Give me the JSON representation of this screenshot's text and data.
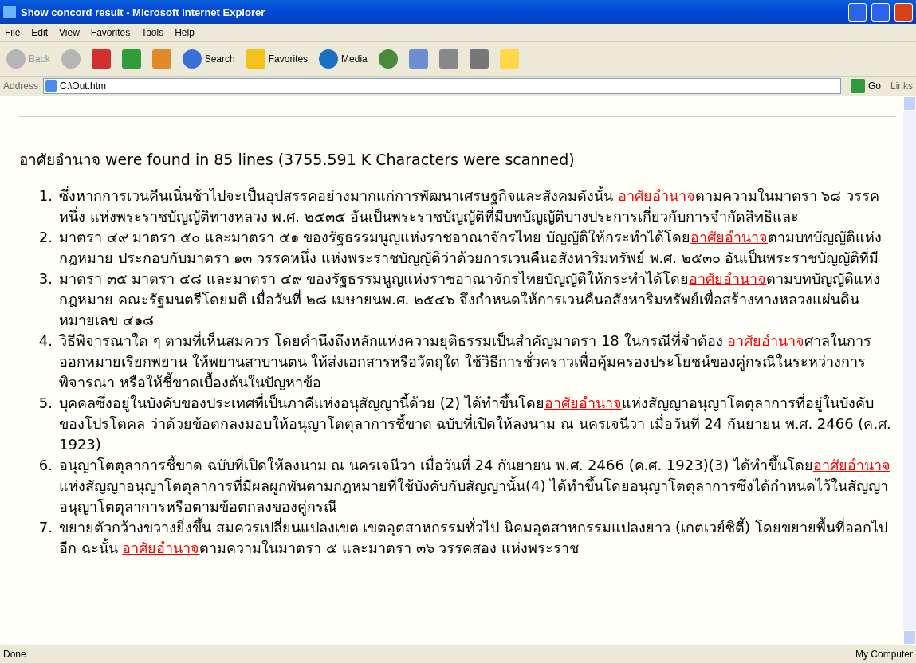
{
  "window": {
    "title": "Show concord result - Microsoft Internet Explorer"
  },
  "menu": [
    "File",
    "Edit",
    "View",
    "Favorites",
    "Tools",
    "Help"
  ],
  "toolbar": [
    {
      "kind": "back",
      "label": "Back",
      "disabled": true
    },
    {
      "kind": "forward",
      "disabled": true
    },
    {
      "kind": "stop"
    },
    {
      "kind": "refresh"
    },
    {
      "kind": "home"
    },
    {
      "kind": "search",
      "label": "Search"
    },
    {
      "kind": "favorites",
      "label": "Favorites"
    },
    {
      "kind": "media",
      "label": "Media"
    },
    {
      "kind": "history"
    },
    {
      "kind": "mail"
    },
    {
      "kind": "print"
    },
    {
      "kind": "edit"
    },
    {
      "kind": "note"
    }
  ],
  "address": {
    "label": "Address",
    "value": "C:\\Out.htm",
    "go": "Go",
    "links": "Links"
  },
  "summary": "อาศัยอำนาจ were found in 85 lines (3755.591 K Characters were scanned)",
  "results": [
    {
      "number": "1.",
      "before": "ซึ่งหากการเวนคืนเนิ่นช้าไปจะเป็นอุปสรรคอย่างมากแก่การพัฒนาเศรษฐกิจและสังคมดังนั้น ",
      "match": "อาศัยอำนาจ",
      "after": "ตามความในมาตรา ๖๘ วรรคหนึ่ง แห่งพระราชบัญญัติทางหลวง พ.ศ. ๒๕๓๕ อันเป็นพระราชบัญญัติที่มีบทบัญญัติบางประการเกี่ยวกับการจำกัดสิทธิและ"
    },
    {
      "number": "2.",
      "before": "มาตรา ๔๙ มาตรา ๕๐ และมาตรา ๕๑ ของรัฐธรรมนูญแห่งราชอาณาจักรไทย บัญญัติให้กระทำได้โดย",
      "match": "อาศัยอำนาจ",
      "after": "ตามบทบัญญัติแห่งกฎหมาย ประกอบกับมาตรา ๑๓ วรรคหนึ่ง แห่งพระราชบัญญัติว่าด้วยการเวนคืนอสังหาริมทรัพย์ พ.ศ. ๒๕๓๐ อันเป็นพระราชบัญญัติที่มี"
    },
    {
      "number": "3.",
      "before": "มาตรา ๓๕ มาตรา ๔๘ และมาตรา ๔๙ ของรัฐธรรมนูญแห่งราชอาณาจักรไทยบัญญัติให้กระทำได้โดย",
      "match": "อาศัยอำนาจ",
      "after": "ตามบทบัญญัติแห่งกฎหมาย คณะรัฐมนตรีโดยมติ เมื่อวันที่ ๒๘ เมษายนพ.ศ. ๒๕๔๖ จึงกำหนดให้การเวนคืนอสังหาริมทรัพย์เพื่อสร้างทางหลวงแผ่นดินหมายเลข ๔๑๘"
    },
    {
      "number": "4.",
      "before": "วิธีพิจารณาใด ๆ ตามที่เห็นสมควร โดยคำนึงถึงหลักแห่งความยุติธรรมเป็นสำคัญมาตรา 18 ในกรณีที่จำต้อง ",
      "match": "อาศัยอำนาจ",
      "after": "ศาลในการออกหมายเรียกพยาน ให้พยานสาบานตน ให้ส่งเอกสารหรือวัตถุใด ใช้วิธีการชั่วคราวเพื่อคุ้มครองประโยชน์ของคู่กรณีในระหว่างการพิจารณา หรือให้ชี้ขาดเบื้องต้นในปัญหาข้อ"
    },
    {
      "number": "5.",
      "before": "บุคคลซึ่งอยู่ในบังคับของประเทศที่เป็นภาคีแห่งอนุสัญญานี้ด้วย (2) ได้ทำขึ้นโดย",
      "match": "อาศัยอำนาจ",
      "after": "แห่งสัญญาอนุญาโตตุลาการที่อยู่ในบังคับของโปรโตคล ว่าด้วยข้อตกลงมอบให้อนุญาโตตุลาการชี้ขาด ฉบับที่เปิดให้ลงนาม ณ นครเจนีวา เมื่อวันที่ 24 กันยายน พ.ศ. 2466 (ค.ศ. 1923)"
    },
    {
      "number": "6.",
      "before": "อนุญาโตตุลาการชี้ขาด ฉบับที่เปิดให้ลงนาม ณ นครเจนีวา เมื่อวันที่ 24 กันยายน พ.ศ. 2466 (ค.ศ. 1923)(3) ได้ทำขึ้นโดย",
      "match": "อาศัยอำนาจ",
      "after": "แห่งสัญญาอนุญาโตตุลาการที่มีผลผูกพันตามกฎหมายที่ใช้บังคับกับสัญญานั้น(4) ได้ทำขึ้นโดยอนุญาโตตุลาการซึ่งได้กำหนดไว้ในสัญญาอนุญาโตตุลาการหรือตามข้อตกลงของคู่กรณี"
    },
    {
      "number": "7.",
      "before": "ขยายตัวกว้างขวางยิ่งขึ้น สมควรเปลี่ยนแปลงเขต เขตอุตสาหกรรมทั่วไป นิคมอุตสาหกรรมแปลงยาว (เกตเวย์ซิตี้) โดยขยายพื้นที่ออกไปอีก ฉะนั้น ",
      "match": "อาศัยอำนาจ",
      "after": "ตามความในมาตรา ๕ และมาตรา ๓๖ วรรคสอง แห่งพระราช"
    }
  ],
  "status": {
    "text": "Done",
    "zone": "My Computer"
  }
}
